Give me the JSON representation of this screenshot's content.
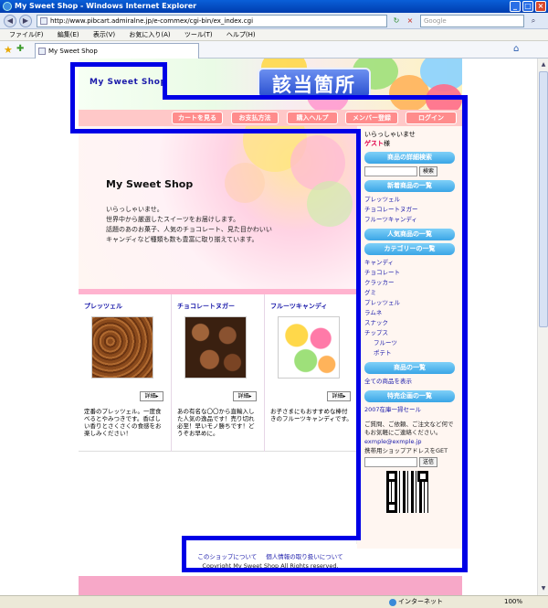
{
  "window": {
    "title": "My Sweet Shop - Windows Internet Explorer",
    "min": "_",
    "max": "□",
    "close": "×"
  },
  "addressbar": {
    "url": "http://www.pibcart.admiralne.jp/e-commex/cgi-bin/ex_index.cgi",
    "search_placeholder": "Google",
    "back": "◀",
    "forward": "▶",
    "refresh": "↻",
    "stop": "×",
    "search_go": "⌕"
  },
  "menubar": [
    "ファイル(F)",
    "編集(E)",
    "表示(V)",
    "お気に入り(A)",
    "ツール(T)",
    "ヘルプ(H)"
  ],
  "favbar": {
    "tab_title": "My Sweet Shop",
    "home": "⌂"
  },
  "header": {
    "logo": "My Sweet Shop",
    "annotation": "該当箇所"
  },
  "nav": [
    "カートを見る",
    "お支払方法",
    "購入ヘルプ",
    "メンバー登録",
    "ログイン"
  ],
  "hero": {
    "title": "My Sweet Shop",
    "lines": [
      "いらっしゃいませ。",
      "世界中から厳選したスイーツをお届けします。",
      "話題のあのお菓子、人気のチョコレート、見た目かわいい",
      "キャンディなど種類も数も豊富に取り揃えています。"
    ]
  },
  "products": [
    {
      "name": "プレッツェル",
      "detail": "詳細▸",
      "desc": "定番のプレッツェル。一度食べるとやみつきです。香ばしい香りとさくさくの食感をお楽しみください！"
    },
    {
      "name": "チョコレートヌガー",
      "detail": "詳細▸",
      "desc": "あの有名な〇〇から直輸入した人気の逸品です！売り切れ必至！早いモノ勝ちです！どうぞお早めに。"
    },
    {
      "name": "フルーツキャンディ",
      "detail": "詳細▸",
      "desc": "お子さまにもおすすめな棒付きのフルーツキャンディです。"
    }
  ],
  "sidebar": {
    "greeting": "いらっしゃいませ",
    "guest": "ゲスト",
    "guest_suffix": "様",
    "detail_search": "商品の詳細検索",
    "search_button": "検索",
    "new_items_head": "新着商品の一覧",
    "new_items": [
      "プレッツェル",
      "チョコレートヌガー",
      "フルーツキャンディ"
    ],
    "popular_head": "人気商品の一覧",
    "category_head": "カテゴリーの一覧",
    "categories": [
      "キャンディ",
      "チョコレート",
      "クラッカー",
      "グミ",
      "プレッツェル",
      "ラムネ",
      "スナック",
      "チップス"
    ],
    "subcategories": [
      "フルーツ",
      "ポテト"
    ],
    "all_items_head": "商品の一覧",
    "all_items_link": "全ての商品を表示",
    "special_head": "特売企画の一覧",
    "special_link": "2007在庫一掃セール",
    "contact_text": "ご質問、ご依頼、ご注文など何でもお気軽にご連絡ください。",
    "email": "exmple@exmple.jp",
    "mobile_label": "携帯用ショップアドレスをGET",
    "send_button": "送信"
  },
  "footer": {
    "links": [
      "このショップについて",
      "個人情報の取り扱いについて"
    ],
    "copyright": "Copyright My Sweet Shop All Rights reserved."
  },
  "statusbar": {
    "zone": "インターネット",
    "zoom": "100%"
  }
}
